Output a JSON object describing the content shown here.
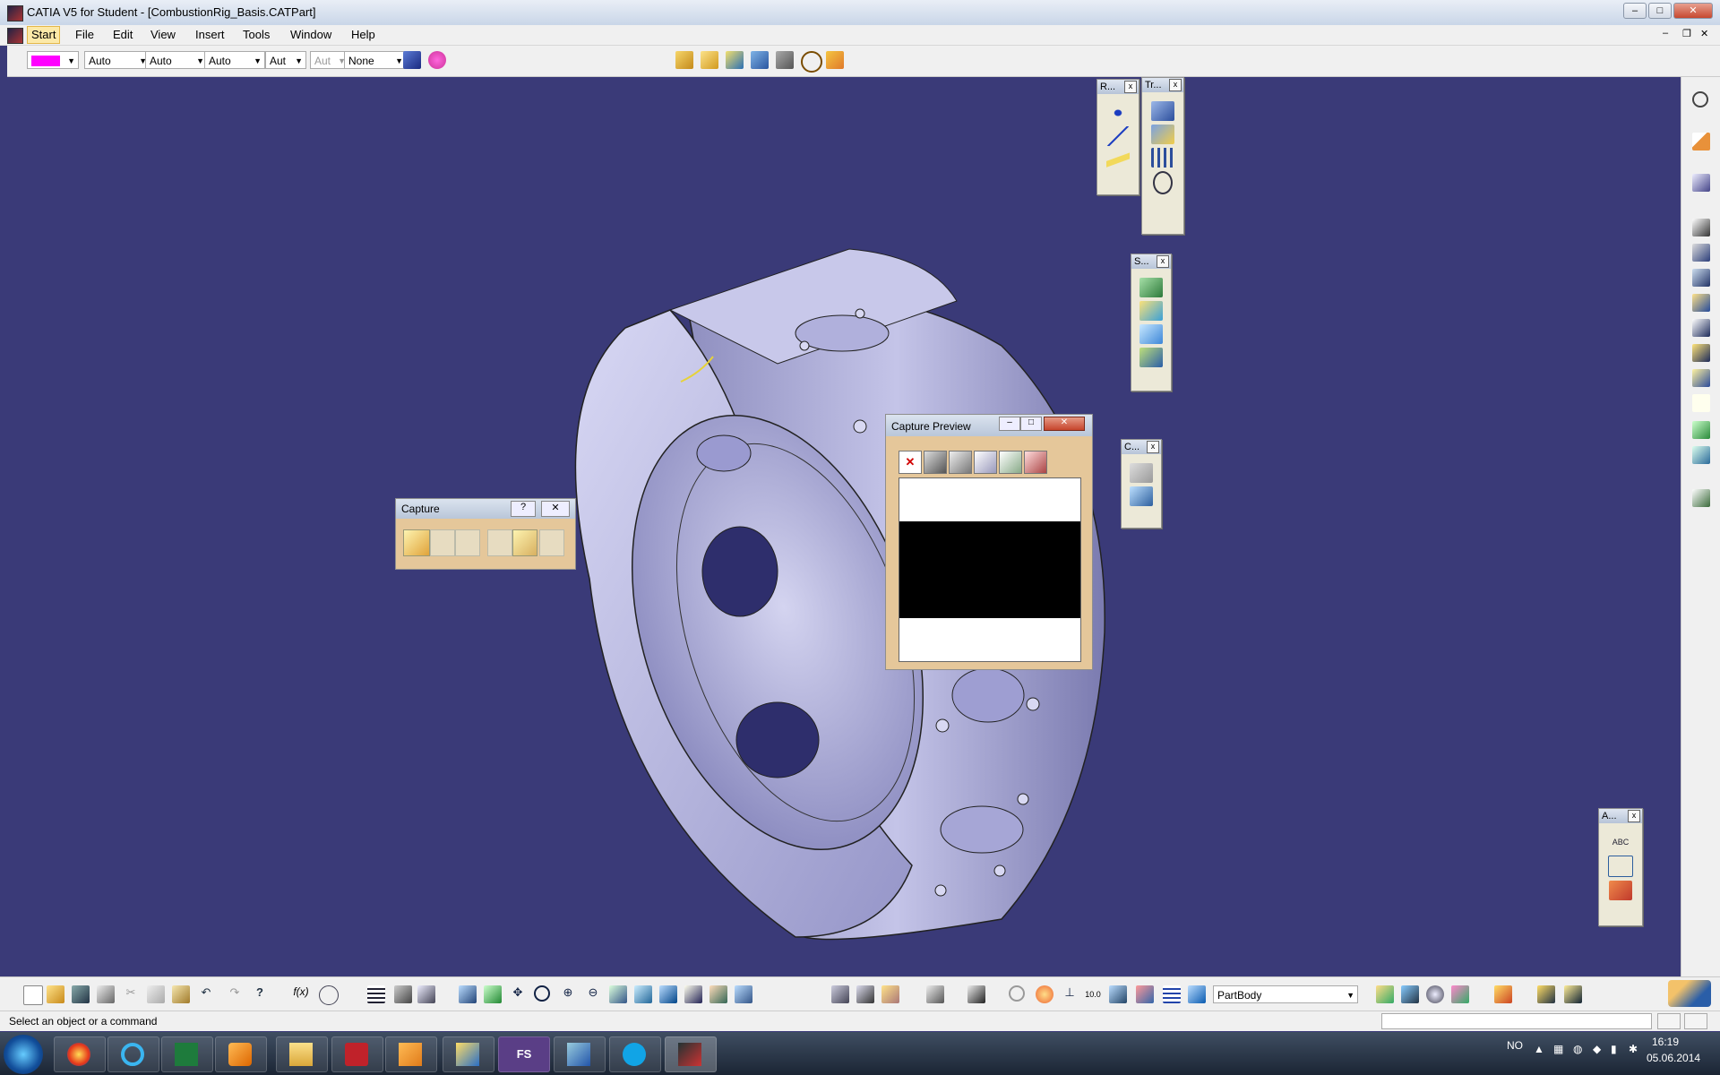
{
  "window": {
    "title": "CATIA V5 for Student - [CombustionRig_Basis.CATPart]"
  },
  "menubar": {
    "items": [
      "Start",
      "File",
      "Edit",
      "View",
      "Insert",
      "Tools",
      "Window",
      "Help"
    ]
  },
  "toolbar_top": {
    "color_value": "#ff00ff",
    "combos": [
      "Auto",
      "Auto",
      "Auto",
      "Aut",
      "Aut",
      "None"
    ]
  },
  "float_toolbars": {
    "reference": "R...",
    "transform": "Tr...",
    "surface": "S...",
    "constraint": "C...",
    "annotation": "A..."
  },
  "capture_toolbar": {
    "title": "Capture",
    "help": "?"
  },
  "capture_preview": {
    "title": "Capture Preview"
  },
  "bottom_toolbar": {
    "part_body_select": "PartBody",
    "fx_label": "f(x)"
  },
  "status": {
    "prompt": "Select an object or a command"
  },
  "taskbar": {
    "apps": [
      "start-orb",
      "firefox-icon",
      "excel-icon",
      "internet-explorer-icon",
      "vmware-icon",
      "media-player-icon",
      "file-explorer-icon",
      "acrobat-icon",
      "outlook-icon",
      "remote-desktop-icon",
      "fs-app-icon",
      "lync-icon",
      "skype-icon",
      "catia-taskbar-icon"
    ],
    "fs_label": "FS",
    "language": "NO",
    "time": "16:19",
    "date": "05.06.2014"
  },
  "colors": {
    "viewport": "#3a3a78",
    "part": "#b8b8e0",
    "active_menu": "#fce9a8"
  }
}
